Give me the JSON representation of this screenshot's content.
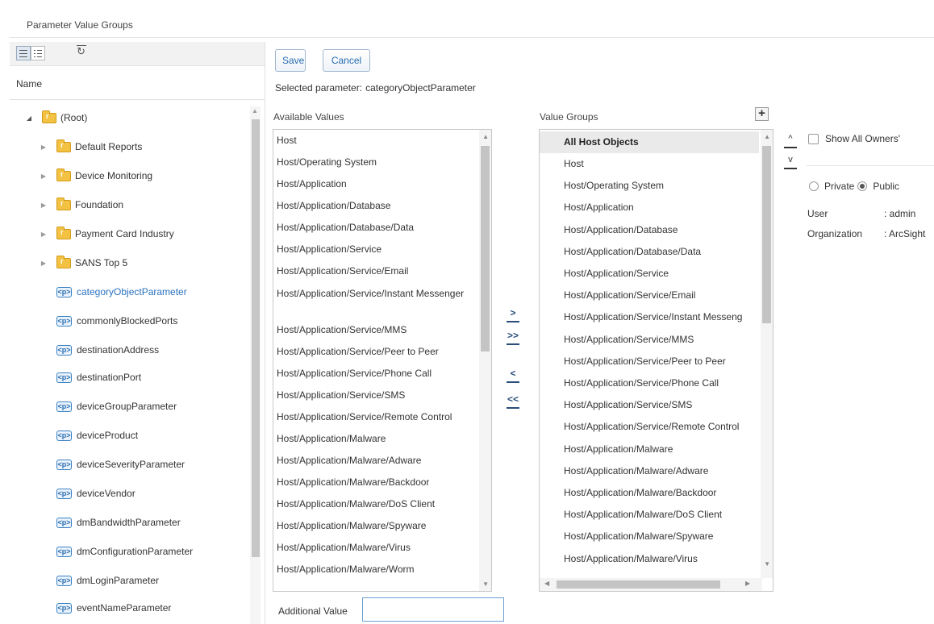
{
  "page": {
    "title": "Parameter Value Groups"
  },
  "tree": {
    "column_header": "Name",
    "items": [
      {
        "label": "(Root)",
        "type": "folder",
        "expanded": true,
        "level": 0
      },
      {
        "label": "Default Reports",
        "type": "folder",
        "level": 1
      },
      {
        "label": "Device Monitoring",
        "type": "folder",
        "level": 1
      },
      {
        "label": "Foundation",
        "type": "folder",
        "level": 1
      },
      {
        "label": "Payment Card Industry",
        "type": "folder",
        "level": 1
      },
      {
        "label": "SANS Top 5",
        "type": "folder",
        "level": 1
      },
      {
        "label": "categoryObjectParameter",
        "type": "parameter",
        "level": 1,
        "selected": true
      },
      {
        "label": "commonlyBlockedPorts",
        "type": "parameter",
        "level": 1
      },
      {
        "label": "destinationAddress",
        "type": "parameter",
        "level": 1
      },
      {
        "label": "destinationPort",
        "type": "parameter",
        "level": 1
      },
      {
        "label": "deviceGroupParameter",
        "type": "parameter",
        "level": 1
      },
      {
        "label": "deviceProduct",
        "type": "parameter",
        "level": 1
      },
      {
        "label": "deviceSeverityParameter",
        "type": "parameter",
        "level": 1
      },
      {
        "label": "deviceVendor",
        "type": "parameter",
        "level": 1
      },
      {
        "label": "dmBandwidthParameter",
        "type": "parameter",
        "level": 1
      },
      {
        "label": "dmConfigurationParameter",
        "type": "parameter",
        "level": 1
      },
      {
        "label": "dmLoginParameter",
        "type": "parameter",
        "level": 1
      },
      {
        "label": "eventNameParameter",
        "type": "parameter",
        "level": 1
      }
    ],
    "param_icon_text": "<p>"
  },
  "toolbar": {
    "save_label": "Save",
    "cancel_label": "Cancel"
  },
  "selected_parameter": {
    "label": "Selected parameter:",
    "value": "categoryObjectParameter"
  },
  "available": {
    "label": "Available Values",
    "values": [
      "Host",
      "Host/Operating System",
      "Host/Application",
      "Host/Application/Database",
      "Host/Application/Database/Data",
      "Host/Application/Service",
      "Host/Application/Service/Email",
      "Host/Application/Service/Instant Messenger",
      "Host/Application/Service/MMS",
      "Host/Application/Service/Peer to Peer",
      "Host/Application/Service/Phone Call",
      "Host/Application/Service/SMS",
      "Host/Application/Service/Remote Control",
      "Host/Application/Malware",
      "Host/Application/Malware/Adware",
      "Host/Application/Malware/Backdoor",
      "Host/Application/Malware/DoS Client",
      "Host/Application/Malware/Spyware",
      "Host/Application/Malware/Virus",
      "Host/Application/Malware/Worm"
    ]
  },
  "groups": {
    "label": "Value Groups",
    "group_name": "All Host Objects",
    "values": [
      "Host",
      "Host/Operating System",
      "Host/Application",
      "Host/Application/Database",
      "Host/Application/Database/Data",
      "Host/Application/Service",
      "Host/Application/Service/Email",
      "Host/Application/Service/Instant Messeng",
      "Host/Application/Service/MMS",
      "Host/Application/Service/Peer to Peer",
      "Host/Application/Service/Phone Call",
      "Host/Application/Service/SMS",
      "Host/Application/Service/Remote Control",
      "Host/Application/Malware",
      "Host/Application/Malware/Adware",
      "Host/Application/Malware/Backdoor",
      "Host/Application/Malware/DoS Client",
      "Host/Application/Malware/Spyware",
      "Host/Application/Malware/Virus"
    ]
  },
  "move_buttons": {
    "add_one": ">",
    "add_all": ">>",
    "remove_one": "<",
    "remove_all": "<<"
  },
  "order_buttons": {
    "up": "^",
    "down": "v"
  },
  "owners": {
    "show_all_label": "Show All Owners'"
  },
  "visibility": {
    "private_label": "Private",
    "public_label": "Public",
    "selected": "Public"
  },
  "info": {
    "user_key": "User",
    "user_value": ": admin",
    "org_key": "Organization",
    "org_value": ": ArcSight"
  },
  "additional": {
    "label": "Additional Value",
    "value": ""
  },
  "icons": [
    "list-view-icon",
    "detail-view-icon",
    "refresh-icon",
    "folder-icon",
    "parameter-icon",
    "add-icon",
    "move-up-icon",
    "move-down-icon"
  ],
  "colors": {
    "selected_text": "#2a72bf",
    "folder": "#f3c242",
    "button_text": "#2a6db0"
  }
}
